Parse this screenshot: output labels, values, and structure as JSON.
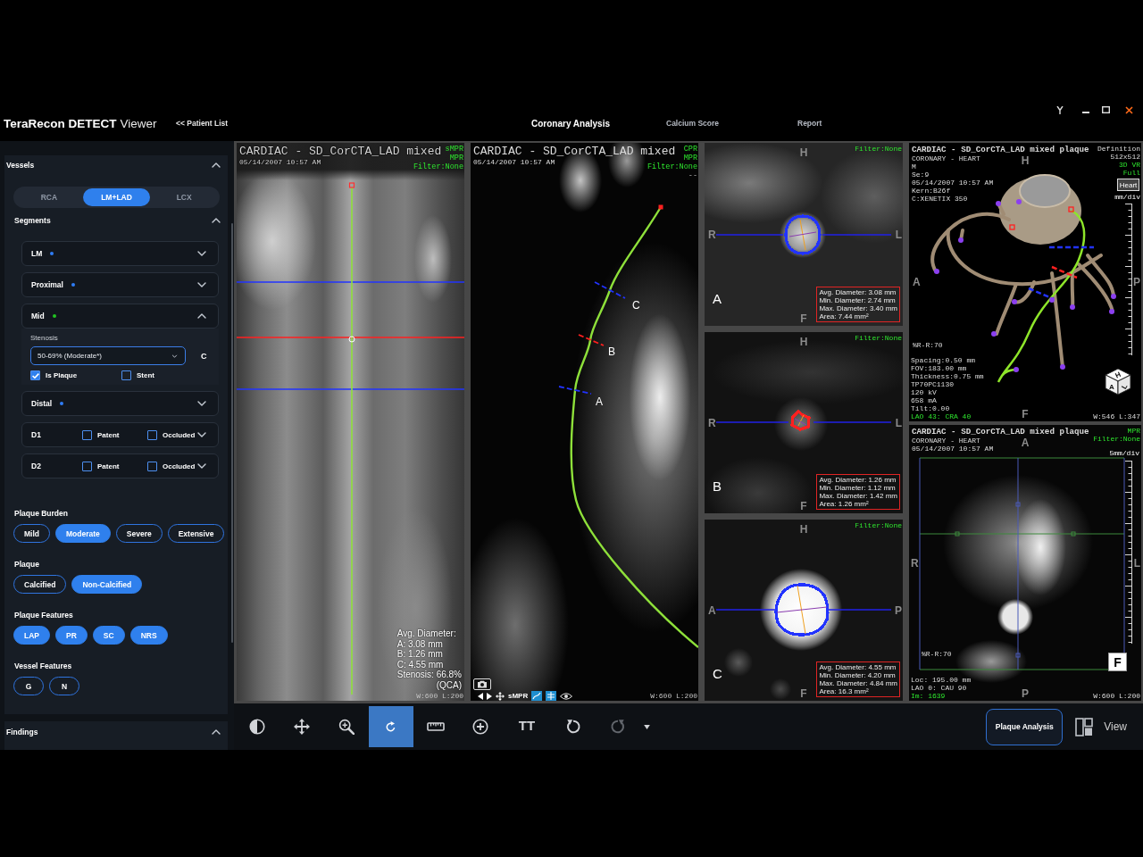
{
  "title_bar": {
    "brand": "TeraRecon DETECT",
    "product": "Viewer",
    "back_link": "<< Patient List",
    "tabs": [
      {
        "label": "Coronary Analysis",
        "selected": true
      },
      {
        "label": "Calcium Score",
        "selected": false
      },
      {
        "label": "Report",
        "selected": false
      }
    ]
  },
  "sidebar": {
    "vessels": {
      "title": "Vessels",
      "expanded": true,
      "tabs": [
        {
          "label": "RCA",
          "selected": false
        },
        {
          "label": "LM+LAD",
          "selected": true
        },
        {
          "label": "LCX",
          "selected": false
        }
      ]
    },
    "segments": {
      "title": "Segments",
      "expanded": true,
      "items": [
        {
          "kind": "segment",
          "name": "LM",
          "color": "#2f7df6",
          "expanded": false
        },
        {
          "kind": "segment",
          "name": "Proximal",
          "color": "#2f7df6",
          "expanded": false
        },
        {
          "kind": "segment",
          "name": "Mid",
          "color": "#22c322",
          "expanded": true,
          "stenosis": {
            "label": "Stenosis",
            "value": "50-69% (Moderate*)",
            "marker": "C"
          },
          "flags": [
            {
              "label": "Is Plaque",
              "checked": true
            },
            {
              "label": "Stent",
              "checked": false
            }
          ]
        },
        {
          "kind": "segment",
          "name": "Distal",
          "color": "#2f7df6",
          "expanded": false
        },
        {
          "kind": "branch",
          "name": "D1",
          "expanded": false,
          "flags": [
            {
              "label": "Patent",
              "checked": false
            },
            {
              "label": "Occluded",
              "checked": false
            }
          ]
        },
        {
          "kind": "branch",
          "name": "D2",
          "expanded": false,
          "flags": [
            {
              "label": "Patent",
              "checked": false
            },
            {
              "label": "Occluded",
              "checked": false
            }
          ]
        }
      ]
    },
    "groups": [
      {
        "title": "Plaque Burden",
        "chips": [
          {
            "label": "Mild",
            "selected": false
          },
          {
            "label": "Moderate",
            "selected": true
          },
          {
            "label": "Severe",
            "selected": false
          },
          {
            "label": "Extensive",
            "selected": false
          }
        ]
      },
      {
        "title": "Plaque",
        "chips": [
          {
            "label": "Calcified",
            "selected": false
          },
          {
            "label": "Non-Calcified",
            "selected": true
          }
        ]
      },
      {
        "title": "Plaque Features",
        "chips": [
          {
            "label": "LAP",
            "selected": true
          },
          {
            "label": "PR",
            "selected": true
          },
          {
            "label": "SC",
            "selected": true
          },
          {
            "label": "NRS",
            "selected": true
          }
        ]
      },
      {
        "title": "Vessel Features",
        "chips": [
          {
            "label": "G",
            "selected": false
          },
          {
            "label": "N",
            "selected": false
          }
        ]
      }
    ],
    "findings": {
      "title": "Findings",
      "expanded": true
    }
  },
  "viewports": {
    "straightened": {
      "title": "CARDIAC - SD_CorCTA_LAD mixed",
      "date": "05/14/2007 10:57 AM",
      "tags": [
        "sMPR",
        "MPR",
        "Filter:None"
      ],
      "measurements": [
        "Avg. Diameter:",
        "A: 3.08 mm",
        "B: 1.26 mm",
        "C: 4.55 mm",
        "Stenosis: 66.8%",
        "(QCA)"
      ],
      "window_level": "W:600 L:200"
    },
    "curved": {
      "title": "CARDIAC - SD_CorCTA_LAD mixed",
      "date": "05/14/2007 10:57 AM",
      "tags": [
        "CPR",
        "MPR",
        "Filter:None"
      ],
      "status": "--",
      "markers": [
        {
          "label": "C",
          "color": "#2233ff"
        },
        {
          "label": "B",
          "color": "#ff2020"
        },
        {
          "label": "A",
          "color": "#2233ff"
        }
      ],
      "mode": "sMPR",
      "window_level": "W:600 L:200"
    },
    "cross_sections": [
      {
        "label": "A",
        "top": "H",
        "bottom": "F",
        "left": "R",
        "right": "L",
        "filter": "Filter:None",
        "color": "#2233ff",
        "stats": [
          "Avg. Diameter: 3.08 mm",
          "Min. Diameter: 2.74 mm",
          "Max. Diameter: 3.40 mm",
          "Area: 7.44 mm²"
        ]
      },
      {
        "label": "B",
        "top": "H",
        "bottom": "F",
        "left": "R",
        "right": "L",
        "filter": "Filter:None",
        "color": "#ff2020",
        "stats": [
          "Avg. Diameter: 1.26 mm",
          "Min. Diameter: 1.12 mm",
          "Max. Diameter: 1.42 mm",
          "Area: 1.26 mm²"
        ]
      },
      {
        "label": "C",
        "top": "H",
        "bottom": "F",
        "left": "A",
        "right": "P",
        "filter": "Filter:None",
        "color": "#2233ff",
        "stats": [
          "Avg. Diameter: 4.55 mm",
          "Min. Diameter: 4.20 mm",
          "Max. Diameter: 4.84 mm",
          "Area: 16.3 mm²"
        ]
      }
    ],
    "volume": {
      "title": "CARDIAC - SD_CorCTA_LAD mixed plaque",
      "info": [
        "CORONARY - HEART",
        "M",
        "Se:9",
        "05/14/2007 10:57 AM",
        "Kern:B26f",
        "C:XENETIX 350"
      ],
      "definition": [
        "Definition",
        "512x512"
      ],
      "render_mode": [
        "3D VR",
        "Full"
      ],
      "preset": "Heart",
      "scale": "mm/div",
      "orientation": {
        "top": "H",
        "left": "A",
        "right": "P",
        "bottom": "F"
      },
      "phase": "%R-R:70",
      "details": [
        "Spacing:0.50 mm",
        "FOV:183.00 mm",
        "Thickness:0.75 mm",
        "TP70PC1130",
        "120 kV",
        "658 mA",
        "Tilt:0.00"
      ],
      "angle": "LAO 43: CRA 40",
      "cube": [
        "H",
        "A",
        "L"
      ],
      "window_level": "W:546 L:347"
    },
    "axial": {
      "title": "CARDIAC - SD_CorCTA_LAD mixed plaque",
      "info": [
        "CORONARY - HEART",
        "05/14/2007 10:57 AM"
      ],
      "tags": [
        "MPR",
        "Filter:None"
      ],
      "orientation": {
        "top": "A",
        "left": "R",
        "right": "L",
        "bottom": "P"
      },
      "scale": "5mm/div",
      "phase": "%R-R:70",
      "details": [
        "Loc: 195.00 mm",
        "LAO 0: CAU 90"
      ],
      "image_number": "Im: 1639",
      "badge": "F",
      "window_level": "W:600 L:200"
    }
  },
  "toolbar": {
    "tools": [
      {
        "kind": "contrast",
        "selected": false,
        "disabled": false
      },
      {
        "kind": "pan",
        "selected": false,
        "disabled": false
      },
      {
        "kind": "zoom",
        "selected": false,
        "disabled": false
      },
      {
        "kind": "rotate",
        "selected": true,
        "disabled": false
      },
      {
        "kind": "measure",
        "selected": false,
        "disabled": false
      },
      {
        "kind": "add-point",
        "selected": false,
        "disabled": false
      },
      {
        "kind": "text",
        "label": "TT",
        "selected": false,
        "disabled": false
      },
      {
        "kind": "reset",
        "selected": false,
        "disabled": false
      },
      {
        "kind": "redo",
        "selected": false,
        "disabled": true
      }
    ],
    "plaque_button": "Plaque Analysis",
    "view_button": "View"
  }
}
